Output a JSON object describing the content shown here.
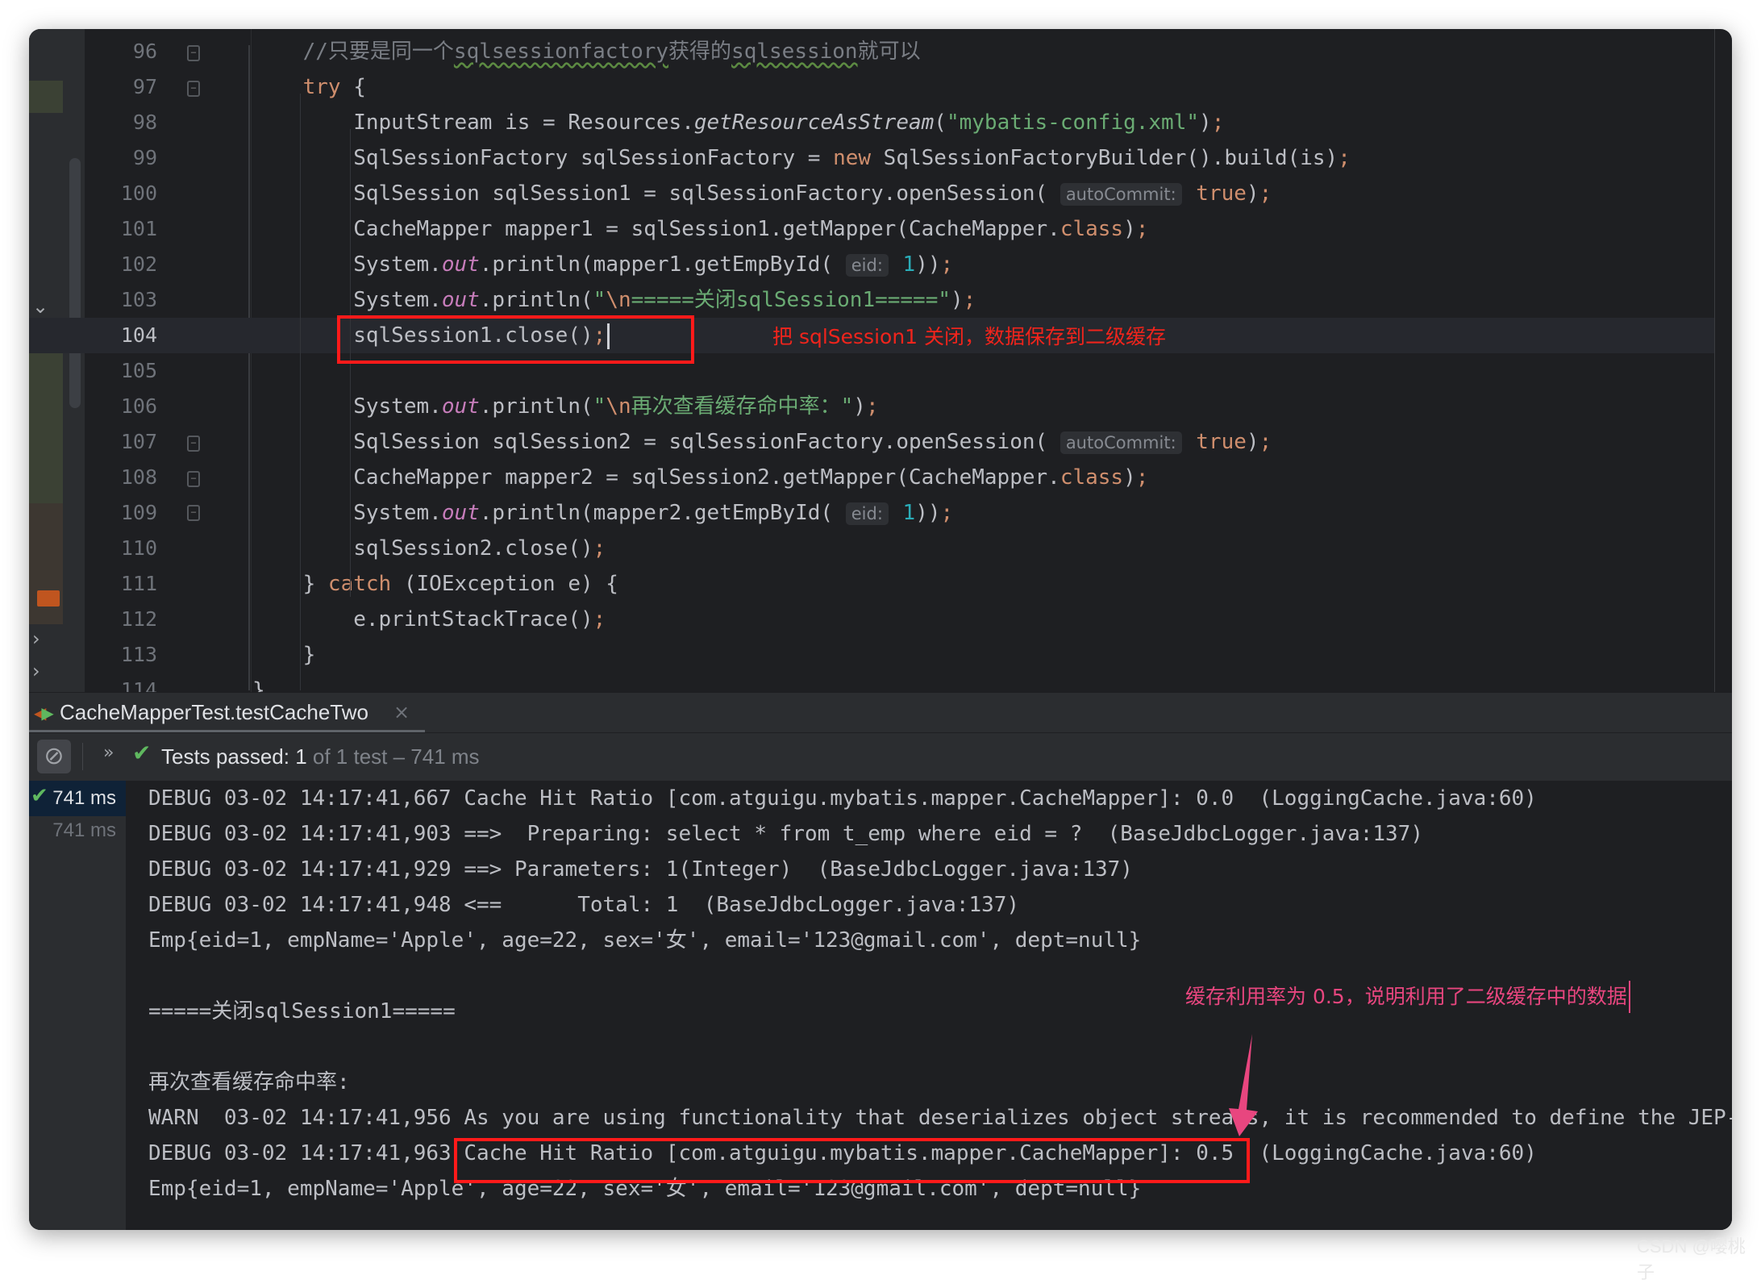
{
  "editor": {
    "current_line": "104",
    "annotation": "把 sqlSession1 关闭，数据保存到二级缓存",
    "lines": [
      {
        "num": "96",
        "segs": [
          {
            "type": "c",
            "text": "    //只要是同一个"
          },
          {
            "type": "cu",
            "text": "sqlsessionfactory"
          },
          {
            "type": "c",
            "text": "获得的"
          },
          {
            "type": "cu",
            "text": "sqlsession"
          },
          {
            "type": "c",
            "text": "就可以"
          }
        ]
      },
      {
        "num": "97",
        "segs": [
          {
            "type": "t",
            "text": "    "
          },
          {
            "type": "k",
            "text": "try"
          },
          {
            "type": "t",
            "text": " {"
          }
        ]
      },
      {
        "num": "98",
        "segs": [
          {
            "type": "t",
            "text": "        InputStream is = Resources."
          },
          {
            "type": "i",
            "text": "getResourceAsStream"
          },
          {
            "type": "t",
            "text": "("
          },
          {
            "type": "s",
            "text": "\"mybatis-config.xml\""
          },
          {
            "type": "t",
            "text": ")"
          },
          {
            "type": "k",
            "text": ";"
          }
        ]
      },
      {
        "num": "99",
        "segs": [
          {
            "type": "t",
            "text": "        SqlSessionFactory sqlSessionFactory = "
          },
          {
            "type": "k",
            "text": "new"
          },
          {
            "type": "t",
            "text": " SqlSessionFactoryBuilder().build(is)"
          },
          {
            "type": "k",
            "text": ";"
          }
        ]
      },
      {
        "num": "100",
        "segs": [
          {
            "type": "t",
            "text": "        SqlSession sqlSession1 = sqlSessionFactory.openSession( "
          },
          {
            "type": "h",
            "text": "autoCommit:"
          },
          {
            "type": "k",
            "text": " true"
          },
          {
            "type": "t",
            "text": ")"
          },
          {
            "type": "k",
            "text": ";"
          }
        ]
      },
      {
        "num": "101",
        "segs": [
          {
            "type": "t",
            "text": "        CacheMapper mapper1 = sqlSession1.getMapper(CacheMapper."
          },
          {
            "type": "k",
            "text": "class"
          },
          {
            "type": "t",
            "text": ")"
          },
          {
            "type": "k",
            "text": ";"
          }
        ]
      },
      {
        "num": "102",
        "segs": [
          {
            "type": "t",
            "text": "        System."
          },
          {
            "type": "st",
            "text": "out"
          },
          {
            "type": "t",
            "text": ".println(mapper1.getEmpById( "
          },
          {
            "type": "h",
            "text": "eid:"
          },
          {
            "type": "n",
            "text": " 1"
          },
          {
            "type": "t",
            "text": "))"
          },
          {
            "type": "k",
            "text": ";"
          }
        ]
      },
      {
        "num": "103",
        "segs": [
          {
            "type": "t",
            "text": "        System."
          },
          {
            "type": "st",
            "text": "out"
          },
          {
            "type": "t",
            "text": ".println("
          },
          {
            "type": "s",
            "text": "\""
          },
          {
            "type": "e",
            "text": "\\n"
          },
          {
            "type": "s",
            "text": "=====关闭sqlSession1=====\""
          },
          {
            "type": "t",
            "text": ")"
          },
          {
            "type": "k",
            "text": ";"
          }
        ]
      },
      {
        "num": "104",
        "segs": [
          {
            "type": "t",
            "text": "        sqlSession1.close()"
          },
          {
            "type": "k",
            "text": ";"
          }
        ]
      },
      {
        "num": "105",
        "segs": []
      },
      {
        "num": "106",
        "segs": [
          {
            "type": "t",
            "text": "        System."
          },
          {
            "type": "st",
            "text": "out"
          },
          {
            "type": "t",
            "text": ".println("
          },
          {
            "type": "s",
            "text": "\""
          },
          {
            "type": "e",
            "text": "\\n"
          },
          {
            "type": "s",
            "text": "再次查看缓存命中率：\""
          },
          {
            "type": "t",
            "text": ")"
          },
          {
            "type": "k",
            "text": ";"
          }
        ]
      },
      {
        "num": "107",
        "segs": [
          {
            "type": "t",
            "text": "        SqlSession sqlSession2 = sqlSessionFactory.openSession( "
          },
          {
            "type": "h",
            "text": "autoCommit:"
          },
          {
            "type": "k",
            "text": " true"
          },
          {
            "type": "t",
            "text": ")"
          },
          {
            "type": "k",
            "text": ";"
          }
        ]
      },
      {
        "num": "108",
        "segs": [
          {
            "type": "t",
            "text": "        CacheMapper mapper2 = sqlSession2.getMapper(CacheMapper."
          },
          {
            "type": "k",
            "text": "class"
          },
          {
            "type": "t",
            "text": ")"
          },
          {
            "type": "k",
            "text": ";"
          }
        ]
      },
      {
        "num": "109",
        "segs": [
          {
            "type": "t",
            "text": "        System."
          },
          {
            "type": "st",
            "text": "out"
          },
          {
            "type": "t",
            "text": ".println(mapper2.getEmpById( "
          },
          {
            "type": "h",
            "text": "eid:"
          },
          {
            "type": "n",
            "text": " 1"
          },
          {
            "type": "t",
            "text": "))"
          },
          {
            "type": "k",
            "text": ";"
          }
        ]
      },
      {
        "num": "110",
        "segs": [
          {
            "type": "t",
            "text": "        sqlSession2.close()"
          },
          {
            "type": "k",
            "text": ";"
          }
        ]
      },
      {
        "num": "111",
        "segs": [
          {
            "type": "t",
            "text": "    } "
          },
          {
            "type": "k",
            "text": "catch"
          },
          {
            "type": "t",
            "text": " (IOException e) {"
          }
        ]
      },
      {
        "num": "112",
        "segs": [
          {
            "type": "t",
            "text": "        e.printStackTrace()"
          },
          {
            "type": "k",
            "text": ";"
          }
        ]
      },
      {
        "num": "113",
        "segs": [
          {
            "type": "t",
            "text": "    }"
          }
        ]
      },
      {
        "num": "114",
        "segs": [
          {
            "type": "t",
            "text": "}"
          }
        ]
      }
    ]
  },
  "run_panel": {
    "tab_label": "CacheMapperTest.testCacheTwo",
    "tab_close": "×",
    "status_passed": "Tests passed: 1",
    "status_detail": " of 1 test – 741 ms",
    "more": "»",
    "tree": [
      {
        "label": "741 ms",
        "passed": true
      },
      {
        "label": "741 ms",
        "passed": false
      }
    ],
    "console": [
      "DEBUG 03-02 14:17:41,667 Cache Hit Ratio [com.atguigu.mybatis.mapper.CacheMapper]: 0.0  (LoggingCache.java:60)",
      "DEBUG 03-02 14:17:41,903 ==>  Preparing: select * from t_emp where eid = ?  (BaseJdbcLogger.java:137)",
      "DEBUG 03-02 14:17:41,929 ==> Parameters: 1(Integer)  (BaseJdbcLogger.java:137)",
      "DEBUG 03-02 14:17:41,948 <==      Total: 1  (BaseJdbcLogger.java:137)",
      "Emp{eid=1, empName='Apple', age=22, sex='女', email='123@gmail.com', dept=null}",
      "",
      "=====关闭sqlSession1=====",
      "",
      "再次查看缓存命中率:",
      "WARN  03-02 14:17:41,956 As you are using functionality that deserializes object streams, it is recommended to define the JEP-",
      "DEBUG 03-02 14:17:41,963 Cache Hit Ratio [com.atguigu.mybatis.mapper.CacheMapper]: 0.5  (LoggingCache.java:60)",
      "Emp{eid=1, empName='Apple', age=22, sex='女', email='123@gmail.com', dept=null}"
    ],
    "annotation": "缓存利用率为 0.5，说明利用了二级缓存中的数据"
  },
  "colors": {
    "highlight_box": "#ff1a1a",
    "annotation_red": "#f0241c",
    "annotation_pink": "#e8467f",
    "pass_green": "#5fb85f"
  },
  "watermark": "CSDN @嘤桃子"
}
